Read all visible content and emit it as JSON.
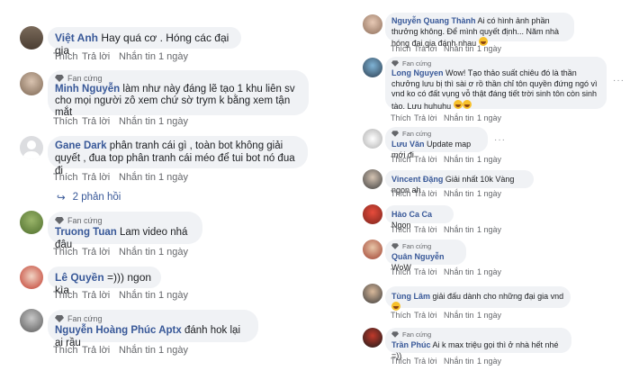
{
  "fan_label": "Fan cứng",
  "actions": {
    "like": "Thích",
    "reply": "Trả lời",
    "message": "Nhắn tin",
    "time": "1 ngày"
  },
  "left_comments": [
    {
      "name": "Việt Anh",
      "text": "Hay quá cơ . Hóng các đại gia",
      "fan": false
    },
    {
      "name": "Minh Nguyễn",
      "text": "làm như này đáng lẽ tạo 1 khu liên sv cho mọi người zô xem chứ sờ trym k bằng xem tận mắt",
      "fan": true
    },
    {
      "name": "Gane Dark",
      "text": "phân tranh cái gì , toàn bot không giải quyết , đua top phân tranh cái méo để tui bot nó đua đi",
      "fan": false
    },
    {
      "name": "Truong Tuan",
      "text": "Lam video nhá đậu",
      "fan": true
    },
    {
      "name": "Lê Quyền",
      "text": "=))) ngon kìa",
      "fan": false
    },
    {
      "name": "Nguyễn Hoàng Phúc Aptx",
      "text": "đánh hok lại ai rầu",
      "fan": true
    }
  ],
  "replies_link": "2 phản hồi",
  "right_comments": [
    {
      "name": "Nguyễn Quang Thành",
      "text": "Ai có hình ảnh phần thưởng không. Để mình quyết định... Năm nhà hóng đại gia đánh nhau",
      "fan": false
    },
    {
      "name": "Long Nguyen",
      "text": "Wow! Tạo thảo suất chiêu đó là thần chưởng lưu bị thì sài ơ rồ thần chỉ tôn quyền đứng ngó vì vnd ko có đất vụng vỗ thật đáng tiết trời sinh tôn còn sinh tào. Lưu huhuhu",
      "fan": true
    },
    {
      "name": "Lưu Văn",
      "text": "Update map mới đi",
      "fan": true
    },
    {
      "name": "Vincent Đặng",
      "text": "Giải nhất 10k Vàng ngon ah",
      "fan": false
    },
    {
      "name": "Hào Ca Ca",
      "text": "Ngon",
      "fan": false
    },
    {
      "name": "Quân Nguyễn",
      "text": "WoW",
      "fan": true
    },
    {
      "name": "Tùng Lâm",
      "text": "giải đấu dành cho những đại gia vnd",
      "fan": false
    },
    {
      "name": "Trần Phúc",
      "text": "Ai k max triệu gọi thì ở nhà hết nhé =))",
      "fan": true
    }
  ],
  "colors": {
    "name": "#385898",
    "bubble": "#f0f2f5",
    "meta": "#65676b"
  }
}
